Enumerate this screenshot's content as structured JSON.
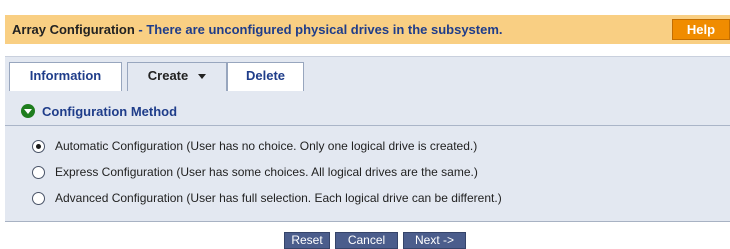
{
  "header": {
    "title": "Array Configuration",
    "subtitle": " - There are unconfigured physical drives in the subsystem.",
    "help_label": "Help"
  },
  "tabs": [
    {
      "label": "Information"
    },
    {
      "label": "Create"
    },
    {
      "label": "Delete"
    }
  ],
  "section": {
    "title": "Configuration Method",
    "icon": "collapse-icon"
  },
  "options": [
    {
      "label": "Automatic Configuration (User has no choice. Only one logical drive is created.)",
      "checked": true
    },
    {
      "label": "Express Configuration (User has some choices. All logical drives are the same.)",
      "checked": false
    },
    {
      "label": "Advanced Configuration (User has full selection. Each logical drive can be different.)",
      "checked": false
    }
  ],
  "buttons": {
    "reset": "Reset",
    "cancel": "Cancel",
    "next": "Next ->"
  },
  "colors": {
    "header_bg": "#f9cf83",
    "help_bg": "#f08c00",
    "panel_bg": "#e3e8f1",
    "link_blue": "#1f3d8a",
    "button_bg": "#4b5d8c",
    "icon_green": "#1e7d1e"
  }
}
